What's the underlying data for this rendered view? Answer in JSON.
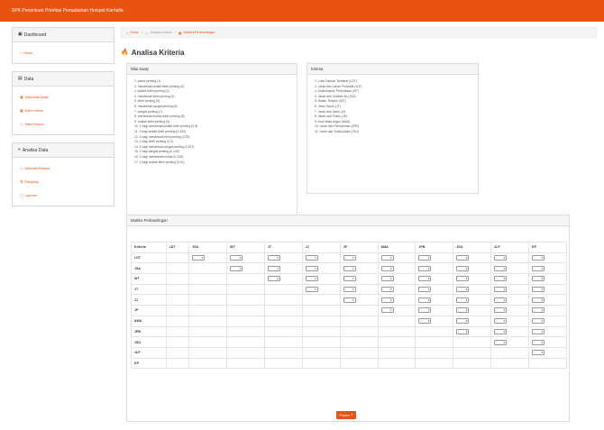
{
  "topbar": {
    "title": "SPK Penentuan Prioritas Pemadaman Hotspot Karhutla"
  },
  "sidebar": {
    "sections": [
      {
        "title": "Dashboard",
        "icon": "dashboard-icon",
        "items": [
          {
            "label": "Home",
            "icon": "home-icon"
          }
        ]
      },
      {
        "title": "Data",
        "icon": "file-icon",
        "items": [
          {
            "label": "Data Nilai Saaty",
            "icon": "table-icon"
          },
          {
            "label": "Data Kriteria",
            "icon": "table-icon"
          },
          {
            "label": "Data Hotspot",
            "icon": "fire-icon"
          }
        ]
      },
      {
        "title": "Analisa Data",
        "icon": "list-icon",
        "items": [
          {
            "label": "Alternatif Hotspot",
            "icon": "flame-icon"
          },
          {
            "label": "Rangking",
            "icon": "sort-icon"
          },
          {
            "label": "Laporan",
            "icon": "report-icon"
          }
        ]
      }
    ]
  },
  "breadcrumb": {
    "home": "Home",
    "mid": "Analisa Kriteria",
    "current": "Matriks Perbandingan",
    "sep": "/"
  },
  "page_title": "Analisa Kriteria",
  "saaty_box": {
    "title": "Nilai Saaty",
    "items": [
      "1. sama penting (1)",
      "2. mendekati sedikit lebih penting (2)",
      "3. sedikit lebih penting (3)",
      "4. mendekati lebih penting (4)",
      "5. lebih penting (5)",
      "6. mendekati sangat penting (6)",
      "7. sangat penting (7)",
      "8. mendekati mutlak lebih penting (8)",
      "9. mutlak lebih penting (9)",
      "10. 1 bagi mendekati sedikit lebih penting (0.5)",
      "11. 1 bagi sedikit lebih penting (0.333)",
      "12. 1 bagi mendekati lebih penting (0.25)",
      "13. 1 bagi lebih penting (0.2)",
      "14. 1 bagi mendekati sangat penting (0.167)",
      "15. 1 bagi sangat penting (0.143)",
      "16. 1 bagi mendekati mutlak (0.125)",
      "17. 1 bagi mutlak lebih penting (0.11)"
    ]
  },
  "kriteria_box": {
    "title": "Kriteria",
    "items": [
      "1. Luas Daerah Terbakar (LDT)",
      "2. Jarak dari Lahan Produktif (JLP)",
      "3. Kelembapan Permukaan (KP)",
      "4. Jarak dari Sumber Air (JSA)",
      "5. Waktu Tempuh (WT)",
      "6. Jenis Tanah (JT)",
      "7. Jarak dari Jalan (JJ)",
      "8. Jarak dari Posko (JP)",
      "9. Arah Mata Angin (AMA)",
      "10. Jarak dari Pemukiman (JPB)",
      "11. Jarak dari Suaka Alam (JSU)"
    ]
  },
  "matrix": {
    "title": "Matriks Perbandingan",
    "corner": "Kriteria",
    "columns": [
      "LDT",
      "JSA",
      "WT",
      "JT",
      "JJ",
      "JP",
      "AMA",
      "JPB",
      "JSU",
      "JLP",
      "KP"
    ],
    "rows": [
      "LDT",
      "JSA",
      "WT",
      "JT",
      "JJ",
      "JP",
      "AMA",
      "JPB",
      "JSU",
      "JLP",
      "KP"
    ],
    "select_value": "-",
    "button": "Proses"
  },
  "colors": {
    "accent": "#e8530f"
  }
}
